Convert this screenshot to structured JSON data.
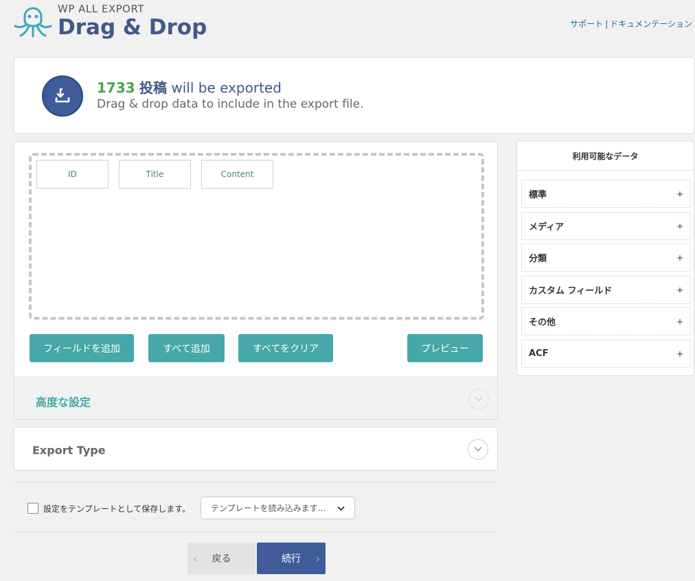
{
  "header": {
    "brand": "WP ALL EXPORT",
    "title": "Drag & Drop",
    "links": [
      "サポート",
      "ドキュメンテーション"
    ],
    "separator": "|"
  },
  "info": {
    "count": "1733",
    "post_type": "投稿",
    "suffix": "will be exported",
    "subtitle": "Drag & drop data to include in the export file."
  },
  "fields": [
    "ID",
    "Title",
    "Content"
  ],
  "buttons": {
    "add_field": "フィールドを追加",
    "add_all": "すべて追加",
    "clear_all": "すべてをクリア",
    "preview": "プレビュー"
  },
  "advanced": {
    "label": "高度な設定"
  },
  "export_type": {
    "label": "Export Type"
  },
  "template": {
    "save_label": "設定をテンプレートとして保存します。",
    "save_checked": false,
    "select_value": "テンプレートを読み込みます..."
  },
  "nav": {
    "back": "戻る",
    "next": "続行"
  },
  "sidebar": {
    "title": "利用可能なデータ",
    "items": [
      {
        "label": "標準",
        "toggle": "+"
      },
      {
        "label": "メディア",
        "toggle": "+"
      },
      {
        "label": "分類",
        "toggle": "+"
      },
      {
        "label": "カスタム フィールド",
        "toggle": "+"
      },
      {
        "label": "その他",
        "toggle": "+"
      },
      {
        "label": "ACF",
        "toggle": "+"
      }
    ]
  },
  "colors": {
    "accent_teal": "#46a8a8",
    "brand_blue": "#3f5b9a",
    "count_green": "#46a74e"
  }
}
